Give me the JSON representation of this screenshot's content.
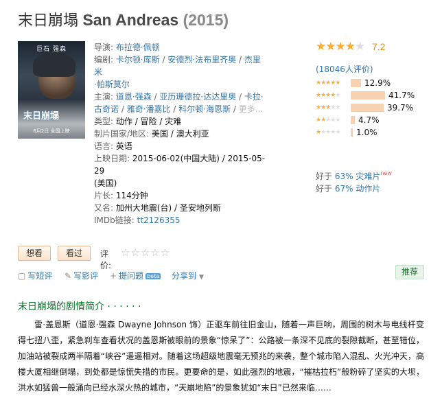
{
  "title": {
    "cn": "末日崩塌",
    "en": "San Andreas",
    "year": "(2015)"
  },
  "poster": {
    "top_text": "巨石 强森",
    "title_text": "末日崩塌",
    "date_text": "6月2日 全国上映"
  },
  "info": {
    "director": {
      "label": "导演:",
      "names": [
        "布拉德·佩顿"
      ]
    },
    "writers": {
      "label": "编剧:",
      "names": [
        "卡尔顿·库斯",
        "安德烈·法布里齐奥",
        "杰里米",
        "·帕斯莫尔"
      ]
    },
    "cast": {
      "label": "主演:",
      "names": [
        "道恩·强森",
        "亚历珊德拉·达达里奥",
        "卡拉·",
        "古奇诺",
        "雅奇·潘嘉比",
        "科尔顿·海恩斯"
      ],
      "more": "更多..."
    },
    "genre": {
      "label": "类型:",
      "value": "动作 / 冒险 / 灾难"
    },
    "country": {
      "label": "制片国家/地区:",
      "value": "美国 / 澳大利亚"
    },
    "language": {
      "label": "语言:",
      "value": "英语"
    },
    "release": {
      "label": "上映日期:",
      "line1": "2015-06-02(中国大陆) / 2015-05-29",
      "line2": "(美国)"
    },
    "runtime": {
      "label": "片长:",
      "value": "114分钟"
    },
    "aka": {
      "label": "又名:",
      "value": "加州大地震(台) / 圣安地列斯"
    },
    "imdb": {
      "label": "IMDb链接:",
      "value": "tt2126355"
    }
  },
  "rating": {
    "score": "7.2",
    "score_stars": 3.5,
    "votes": "(18046人评价)",
    "distribution": [
      {
        "stars": 5,
        "pct": "12.9%",
        "value": 12.9
      },
      {
        "stars": 4,
        "pct": "41.7%",
        "value": 41.7
      },
      {
        "stars": 3,
        "pct": "39.7%",
        "value": 39.7
      },
      {
        "stars": 2,
        "pct": "4.7%",
        "value": 4.7
      },
      {
        "stars": 1,
        "pct": "1.0%",
        "value": 1.0
      }
    ],
    "better": [
      {
        "prefix": "好于",
        "link": "63% 灾难片",
        "badge": "new"
      },
      {
        "prefix": "好于",
        "link": "67% 动作片",
        "badge": ""
      }
    ]
  },
  "actions": {
    "want": "想看",
    "seen": "看过",
    "rate_label": "评价:",
    "rate_stars": "☆☆☆☆☆"
  },
  "tools": {
    "comment": "写短评",
    "review": "写影评",
    "question": "提问题",
    "beta": "beta",
    "share": "分享到",
    "recommend": "推荐",
    "icons": {
      "comment": "speech-bubble-icon",
      "review": "pencil-icon",
      "question": "plus-icon",
      "share": "share-icon"
    }
  },
  "summary": {
    "title": "末日崩塌的剧情简介 · · · · · ·",
    "text": "雷·盖恩斯（道恩·强森 Dwayne Johnson 饰）正驱车前往旧金山，随着一声巨响，周围的树木与电线杆变得七扭八歪，紧急刹车查看状况的盖恩斯被眼前的景象“惊呆了”：公路被一条深不见底的裂隙截断，甚至错位，加油站被裂成两半隔着“峡谷”遥遥相对。随着这场超级地震毫无预兆的来袭，整个城市陷入混乱、火光冲天，高楼大厦相继倒塌，到处都是惊慌失措的市民。更要命的是，如此强烈的地震，“摧枯拉朽”般粉碎了坚实的大坝，洪水如猛兽一般涌向已经水深火热的城市，“天崩地陷”的景象犹如“末日”已然来临……"
  },
  "colors": {
    "link": "#3377aa",
    "star": "#ffac2d",
    "score": "#e09015",
    "bar": "#f7d3b3",
    "summary_title": "#007722"
  }
}
